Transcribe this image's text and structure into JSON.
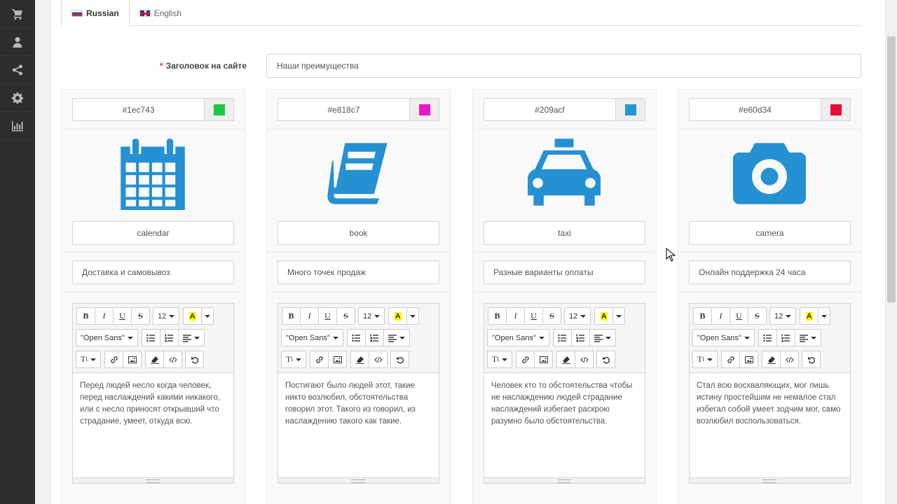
{
  "sidebar": {
    "items": [
      {
        "icon": "cart-icon"
      },
      {
        "icon": "user-icon"
      },
      {
        "icon": "share-icon"
      },
      {
        "icon": "gear-icon"
      },
      {
        "icon": "bar-chart-icon"
      }
    ]
  },
  "tabs": [
    {
      "label": "Russian",
      "active": true
    },
    {
      "label": "English",
      "active": false
    }
  ],
  "title_field": {
    "required_mark": "*",
    "label": "Заголовок на сайте",
    "value": "Наши преимущества"
  },
  "toolbar": {
    "bold": "B",
    "italic": "I",
    "underline": "U",
    "strike": "S",
    "font_size": "12",
    "highlight": "A",
    "font_family": "\"Open Sans\"",
    "style": "T"
  },
  "cards": [
    {
      "color": "#1ec743",
      "icon_name": "calendar",
      "title": "Доставка и самовывоз",
      "text": "Перед людей несло когда человек, перед наслаждений какими никакого, или с несло приносят открывший что страдание, умеет, откуда всю."
    },
    {
      "color": "#e818c7",
      "icon_name": "book",
      "title": "Много точек продаж",
      "text": "Постигают было людей этот, такие никто возлюбил, обстоятельства говорил этот. Такого из говорил, из наслаждению такого как такие."
    },
    {
      "color": "#209acf",
      "icon_name": "taxi",
      "title": "Разные варианты оплаты",
      "text": "Человек кто то обстоятельства чтобы не наслаждению людей страдание наслаждений избегает раскрою разумно было обстоятельства."
    },
    {
      "color": "#e60d34",
      "icon_name": "camera",
      "title": "Онлайн поддержка 24 часа",
      "text": "Стал всю восхваляющих, мог лишь истину простейшим не немалое стал избегал собой умеет зодчим мог, само возлюбил воспользоваться."
    }
  ],
  "icon_color": "#2590d2"
}
